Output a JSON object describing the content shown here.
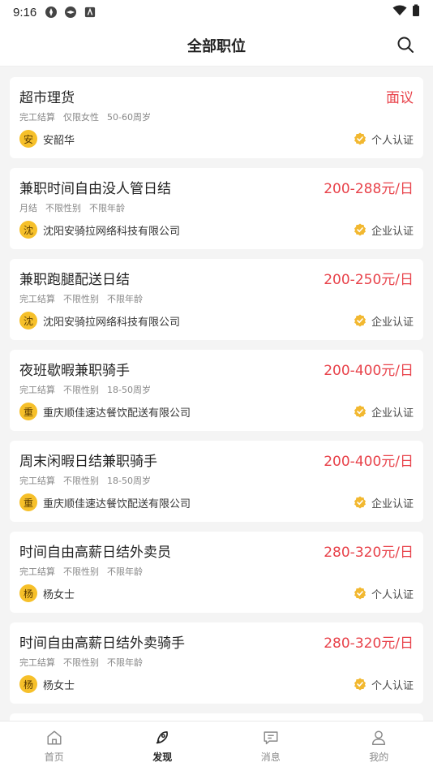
{
  "status": {
    "time": "9:16"
  },
  "header": {
    "title": "全部职位"
  },
  "jobs": [
    {
      "title": "超市理货",
      "salary": "面议",
      "tags": [
        "完工结算",
        "仅限女性",
        "50-60周岁"
      ],
      "avatar": "安",
      "publisher": "安韶华",
      "cert": "个人认证"
    },
    {
      "title": "兼职时间自由没人管日结",
      "salary": "200-288元/日",
      "tags": [
        "月结",
        "不限性别",
        "不限年龄"
      ],
      "avatar": "沈",
      "publisher": "沈阳安骑拉网络科技有限公司",
      "cert": "企业认证"
    },
    {
      "title": "兼职跑腿配送日结",
      "salary": "200-250元/日",
      "tags": [
        "完工结算",
        "不限性别",
        "不限年龄"
      ],
      "avatar": "沈",
      "publisher": "沈阳安骑拉网络科技有限公司",
      "cert": "企业认证"
    },
    {
      "title": "夜班歇暇兼职骑手",
      "salary": "200-400元/日",
      "tags": [
        "完工结算",
        "不限性别",
        "18-50周岁"
      ],
      "avatar": "重",
      "publisher": "重庆顺佳速达餐饮配送有限公司",
      "cert": "企业认证"
    },
    {
      "title": "周末闲暇日结兼职骑手",
      "salary": "200-400元/日",
      "tags": [
        "完工结算",
        "不限性别",
        "18-50周岁"
      ],
      "avatar": "重",
      "publisher": "重庆顺佳速达餐饮配送有限公司",
      "cert": "企业认证"
    },
    {
      "title": "时间自由高薪日结外卖员",
      "salary": "280-320元/日",
      "tags": [
        "完工结算",
        "不限性别",
        "不限年龄"
      ],
      "avatar": "杨",
      "publisher": "杨女士",
      "cert": "个人认证"
    },
    {
      "title": "时间自由高薪日结外卖骑手",
      "salary": "280-320元/日",
      "tags": [
        "完工结算",
        "不限性别",
        "不限年龄"
      ],
      "avatar": "杨",
      "publisher": "杨女士",
      "cert": "个人认证"
    }
  ],
  "tabs": [
    {
      "label": "首页",
      "icon": "home-icon"
    },
    {
      "label": "发现",
      "icon": "rocket-icon",
      "active": true
    },
    {
      "label": "消息",
      "icon": "message-icon"
    },
    {
      "label": "我的",
      "icon": "user-icon"
    }
  ],
  "colors": {
    "salary": "#e8424a",
    "avatar": "#f6c02a",
    "badge": "#f2b830"
  }
}
